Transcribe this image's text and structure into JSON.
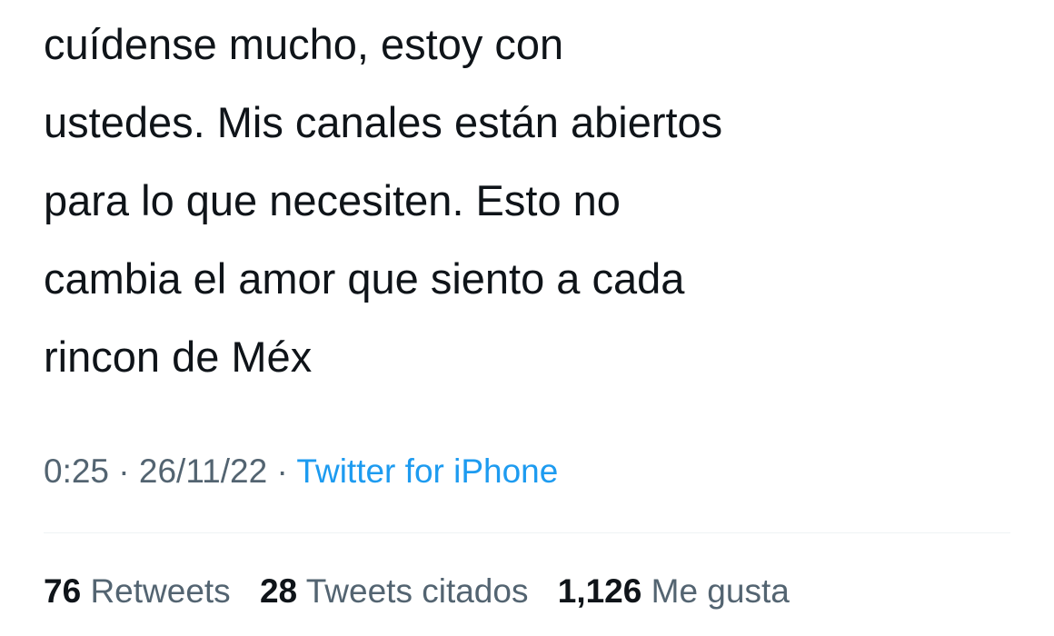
{
  "tweet": {
    "text_lines": [
      "cuídense mucho, estoy con",
      "ustedes. Mis canales están abiertos",
      "para lo que necesiten. Esto no",
      "cambia el amor que siento a cada",
      "rincon de Méx"
    ],
    "time": "0:25",
    "separator": "·",
    "date": "26/11/22",
    "source": "Twitter for iPhone"
  },
  "stats": {
    "retweets_count": "76",
    "retweets_label": "Retweets",
    "quotes_count": "28",
    "quotes_label": "Tweets citados",
    "likes_count": "1,126",
    "likes_label": "Me gusta"
  },
  "colors": {
    "text": "#0f1419",
    "secondary": "#536471",
    "link": "#1d9bf0",
    "divider": "#eff3f4"
  }
}
